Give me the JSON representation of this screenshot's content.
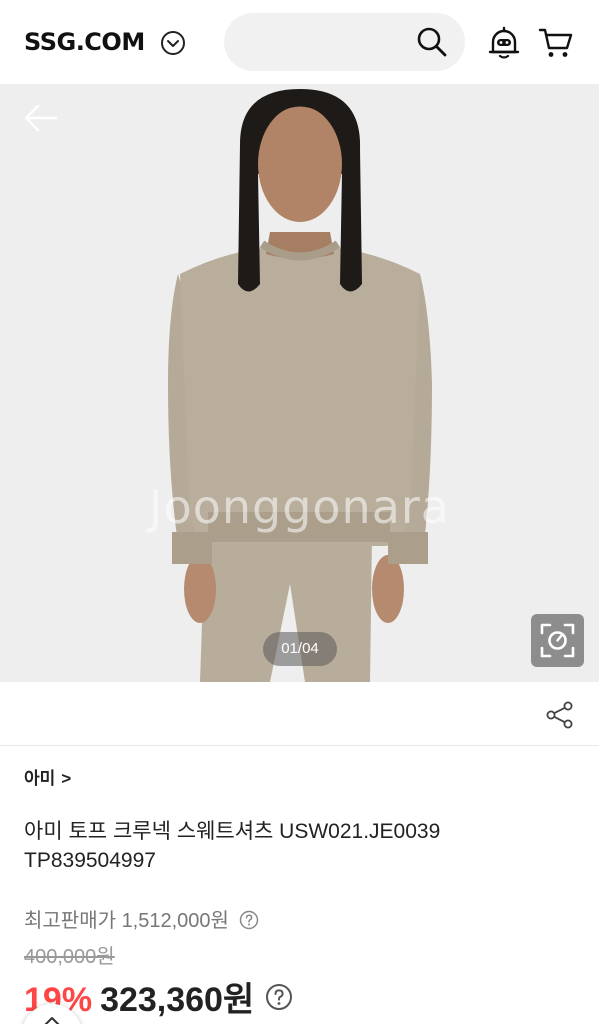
{
  "header": {
    "logo": "SSG.COM",
    "search": {
      "value": "",
      "placeholder": ""
    }
  },
  "gallery": {
    "watermark": "Joonggonara",
    "counter": "01/04"
  },
  "product": {
    "brand": "아미",
    "brand_chevron": ">",
    "title": "아미 토프 크루넥 스웨트셔츠 USW021.JE0039 TP839504997",
    "max_price_label": "최고판매가",
    "max_price_value": "1,512,000원",
    "original_price": "400,000원",
    "discount_rate": "19%",
    "sale_price": "323,360원"
  },
  "colors": {
    "discount": "#ff4646",
    "search_bg": "#f1f1f1",
    "gallery_bg": "#eeeeee"
  }
}
